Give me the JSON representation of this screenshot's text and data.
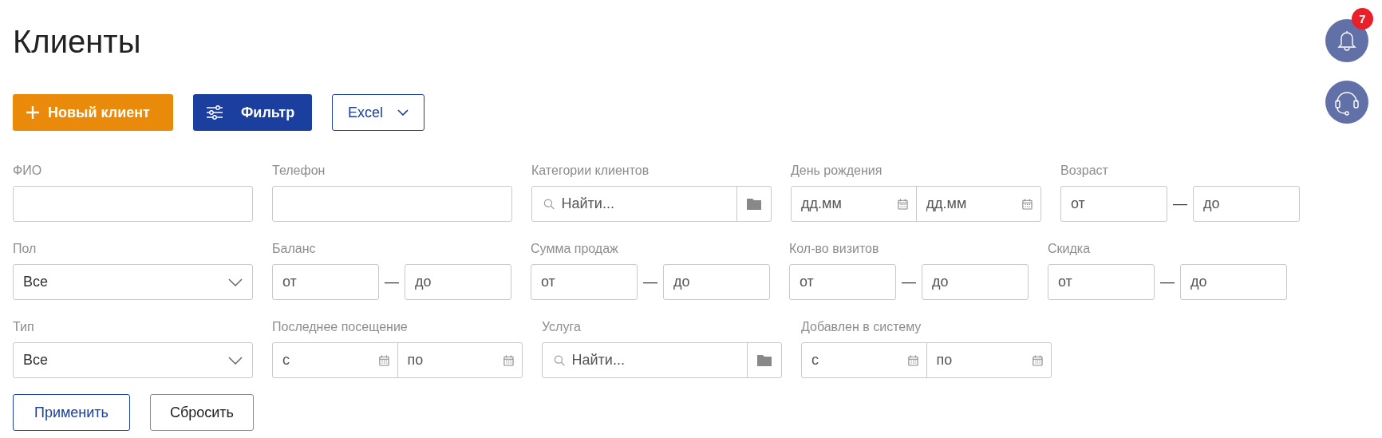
{
  "title": "Клиенты",
  "notifications": {
    "badge": "7"
  },
  "actions": [
    {
      "kind": "primary",
      "label": "Новый клиент"
    },
    {
      "kind": "filter",
      "label": "Фильтр"
    },
    {
      "kind": "dropdown",
      "label": "Excel"
    }
  ],
  "filter_rows": [
    [
      {
        "kind": "text",
        "label": "ФИО"
      },
      {
        "kind": "text",
        "label": "Телефон"
      },
      {
        "kind": "search",
        "label": "Категории клиентов",
        "placeholder": "Найти..."
      },
      {
        "kind": "date-range",
        "label": "День рождения",
        "from_placeholder": "дд.мм",
        "to_placeholder": "дд.мм"
      },
      {
        "kind": "range",
        "label": "Возраст",
        "from_placeholder": "от",
        "separator": "—",
        "to_placeholder": "до"
      }
    ],
    [
      {
        "kind": "select",
        "label": "Пол",
        "value": "Все"
      },
      {
        "kind": "range",
        "label": "Баланс",
        "from_placeholder": "от",
        "separator": "—",
        "to_placeholder": "до"
      },
      {
        "kind": "range",
        "label": "Сумма продаж",
        "from_placeholder": "от",
        "separator": "—",
        "to_placeholder": "до"
      },
      {
        "kind": "range",
        "label": "Кол-во визитов",
        "from_placeholder": "от",
        "separator": "—",
        "to_placeholder": "до"
      },
      {
        "kind": "range",
        "label": "Скидка",
        "from_placeholder": "от",
        "separator": "—",
        "to_placeholder": "до"
      }
    ],
    [
      {
        "kind": "select",
        "label": "Тип",
        "value": "Все"
      },
      {
        "kind": "date-range",
        "label": "Последнее посещение",
        "from_placeholder": "с",
        "to_placeholder": "по"
      },
      {
        "kind": "search",
        "label": "Услуга",
        "placeholder": "Найти..."
      },
      {
        "kind": "date-range",
        "label": "Добавлен в систему",
        "from_placeholder": "с",
        "to_placeholder": "по"
      }
    ]
  ],
  "form_buttons": [
    {
      "kind": "apply",
      "label": "Применить"
    },
    {
      "kind": "reset",
      "label": "Сбросить"
    }
  ]
}
